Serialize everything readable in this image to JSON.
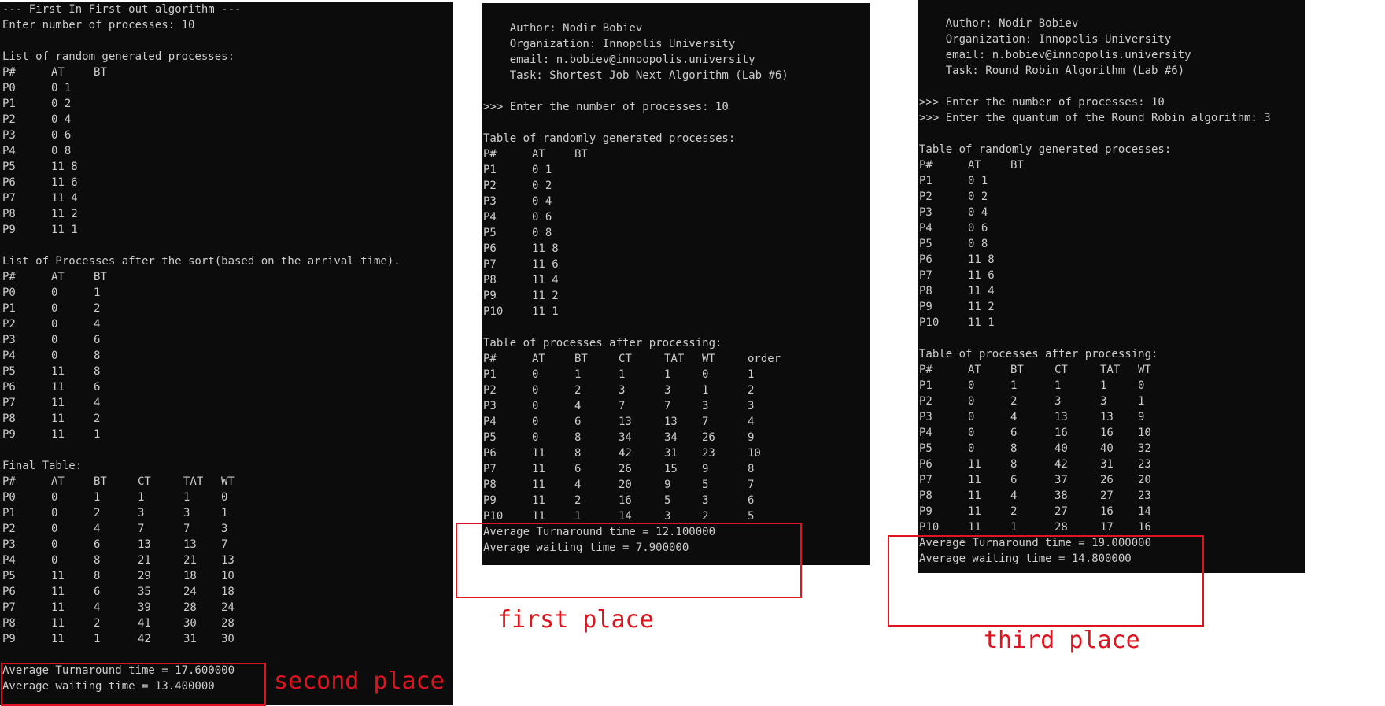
{
  "fcfs": {
    "lines": [
      "--- First In First out algorithm ---",
      "Enter number of processes: 10",
      "",
      "List of random generated processes:"
    ],
    "random_table": {
      "headers": [
        "P#",
        "AT",
        "BT"
      ],
      "rows": [
        [
          "P0",
          "0 1"
        ],
        [
          "P1",
          "0 2"
        ],
        [
          "P2",
          "0 4"
        ],
        [
          "P3",
          "0 6"
        ],
        [
          "P4",
          "0 8"
        ],
        [
          "P5",
          "11 8"
        ],
        [
          "P6",
          "11 6"
        ],
        [
          "P7",
          "11 4"
        ],
        [
          "P8",
          "11 2"
        ],
        [
          "P9",
          "11 1"
        ]
      ]
    },
    "sorted_title": "List of Processes after the sort(based on the arrival time).",
    "sorted_table": {
      "headers": [
        "P#",
        "AT",
        "BT"
      ],
      "rows": [
        [
          "P0",
          "0",
          "1"
        ],
        [
          "P1",
          "0",
          "2"
        ],
        [
          "P2",
          "0",
          "4"
        ],
        [
          "P3",
          "0",
          "6"
        ],
        [
          "P4",
          "0",
          "8"
        ],
        [
          "P5",
          "11",
          "8"
        ],
        [
          "P6",
          "11",
          "6"
        ],
        [
          "P7",
          "11",
          "4"
        ],
        [
          "P8",
          "11",
          "2"
        ],
        [
          "P9",
          "11",
          "1"
        ]
      ]
    },
    "final_title": "Final Table:",
    "final_table": {
      "headers": [
        "P#",
        "AT",
        "BT",
        "CT",
        "TAT",
        "WT"
      ],
      "rows": [
        [
          "P0",
          "0",
          "1",
          "1",
          "1",
          "0"
        ],
        [
          "P1",
          "0",
          "2",
          "3",
          "3",
          "1"
        ],
        [
          "P2",
          "0",
          "4",
          "7",
          "7",
          "3"
        ],
        [
          "P3",
          "0",
          "6",
          "13",
          "13",
          "7"
        ],
        [
          "P4",
          "0",
          "8",
          "21",
          "21",
          "13"
        ],
        [
          "P5",
          "11",
          "8",
          "29",
          "18",
          "10"
        ],
        [
          "P6",
          "11",
          "6",
          "35",
          "24",
          "18"
        ],
        [
          "P7",
          "11",
          "4",
          "39",
          "28",
          "24"
        ],
        [
          "P8",
          "11",
          "2",
          "41",
          "30",
          "28"
        ],
        [
          "P9",
          "11",
          "1",
          "42",
          "31",
          "30"
        ]
      ]
    },
    "avg_turnaround": "Average Turnaround time = 17.600000",
    "avg_waiting": "Average waiting time = 13.400000",
    "place_label": "second place"
  },
  "sjn": {
    "header_lines": [
      "    Author: Nodir Bobiev",
      "    Organization: Innopolis University",
      "    email: n.bobiev@innoopolis.university",
      "    Task: Shortest Job Next Algorithm (Lab #6)",
      "",
      ">>> Enter the number of processes: 10",
      "",
      "Table of randomly generated processes:"
    ],
    "random_table": {
      "headers": [
        "P#",
        "AT",
        "BT"
      ],
      "rows": [
        [
          "P1",
          "0 1"
        ],
        [
          "P2",
          "0 2"
        ],
        [
          "P3",
          "0 4"
        ],
        [
          "P4",
          "0 6"
        ],
        [
          "P5",
          "0 8"
        ],
        [
          "P6",
          "11 8"
        ],
        [
          "P7",
          "11 6"
        ],
        [
          "P8",
          "11 4"
        ],
        [
          "P9",
          "11 2"
        ],
        [
          "P10",
          "11 1"
        ]
      ]
    },
    "processed_title": "Table of processes after processing:",
    "processed_table": {
      "headers": [
        "P#",
        "AT",
        "BT",
        "CT",
        "TAT",
        "WT",
        "order"
      ],
      "rows": [
        [
          "P1",
          "0",
          "1",
          "1",
          "1",
          "0",
          "1"
        ],
        [
          "P2",
          "0",
          "2",
          "3",
          "3",
          "1",
          "2"
        ],
        [
          "P3",
          "0",
          "4",
          "7",
          "7",
          "3",
          "3"
        ],
        [
          "P4",
          "0",
          "6",
          "13",
          "13",
          "7",
          "4"
        ],
        [
          "P5",
          "0",
          "8",
          "34",
          "34",
          "26",
          "9"
        ],
        [
          "P6",
          "11",
          "8",
          "42",
          "31",
          "23",
          "10"
        ],
        [
          "P7",
          "11",
          "6",
          "26",
          "15",
          "9",
          "8"
        ],
        [
          "P8",
          "11",
          "4",
          "20",
          "9",
          "5",
          "7"
        ],
        [
          "P9",
          "11",
          "2",
          "16",
          "5",
          "3",
          "6"
        ],
        [
          "P10",
          "11",
          "1",
          "14",
          "3",
          "2",
          "5"
        ]
      ]
    },
    "avg_turnaround": "Average Turnaround time = 12.100000",
    "avg_waiting": "Average waiting time = 7.900000",
    "place_label": "first place"
  },
  "rr": {
    "header_lines": [
      "    Author: Nodir Bobiev",
      "    Organization: Innopolis University",
      "    email: n.bobiev@innoopolis.university",
      "    Task: Round Robin Algorithm (Lab #6)",
      "",
      ">>> Enter the number of processes: 10",
      ">>> Enter the quantum of the Round Robin algorithm: 3",
      "",
      "Table of randomly generated processes:"
    ],
    "random_table": {
      "headers": [
        "P#",
        "AT",
        "BT"
      ],
      "rows": [
        [
          "P1",
          "0 1"
        ],
        [
          "P2",
          "0 2"
        ],
        [
          "P3",
          "0 4"
        ],
        [
          "P4",
          "0 6"
        ],
        [
          "P5",
          "0 8"
        ],
        [
          "P6",
          "11 8"
        ],
        [
          "P7",
          "11 6"
        ],
        [
          "P8",
          "11 4"
        ],
        [
          "P9",
          "11 2"
        ],
        [
          "P10",
          "11 1"
        ]
      ]
    },
    "processed_title": "Table of processes after processing:",
    "processed_table": {
      "headers": [
        "P#",
        "AT",
        "BT",
        "CT",
        "TAT",
        "WT"
      ],
      "rows": [
        [
          "P1",
          "0",
          "1",
          "1",
          "1",
          "0"
        ],
        [
          "P2",
          "0",
          "2",
          "3",
          "3",
          "1"
        ],
        [
          "P3",
          "0",
          "4",
          "13",
          "13",
          "9"
        ],
        [
          "P4",
          "0",
          "6",
          "16",
          "16",
          "10"
        ],
        [
          "P5",
          "0",
          "8",
          "40",
          "40",
          "32"
        ],
        [
          "P6",
          "11",
          "8",
          "42",
          "31",
          "23"
        ],
        [
          "P7",
          "11",
          "6",
          "37",
          "26",
          "20"
        ],
        [
          "P8",
          "11",
          "4",
          "38",
          "27",
          "23"
        ],
        [
          "P9",
          "11",
          "2",
          "27",
          "16",
          "14"
        ],
        [
          "P10",
          "11",
          "1",
          "28",
          "17",
          "16"
        ]
      ]
    },
    "avg_turnaround": "Average Turnaround time = 19.000000",
    "avg_waiting": "Average waiting time = 14.800000",
    "place_label": "third place"
  }
}
